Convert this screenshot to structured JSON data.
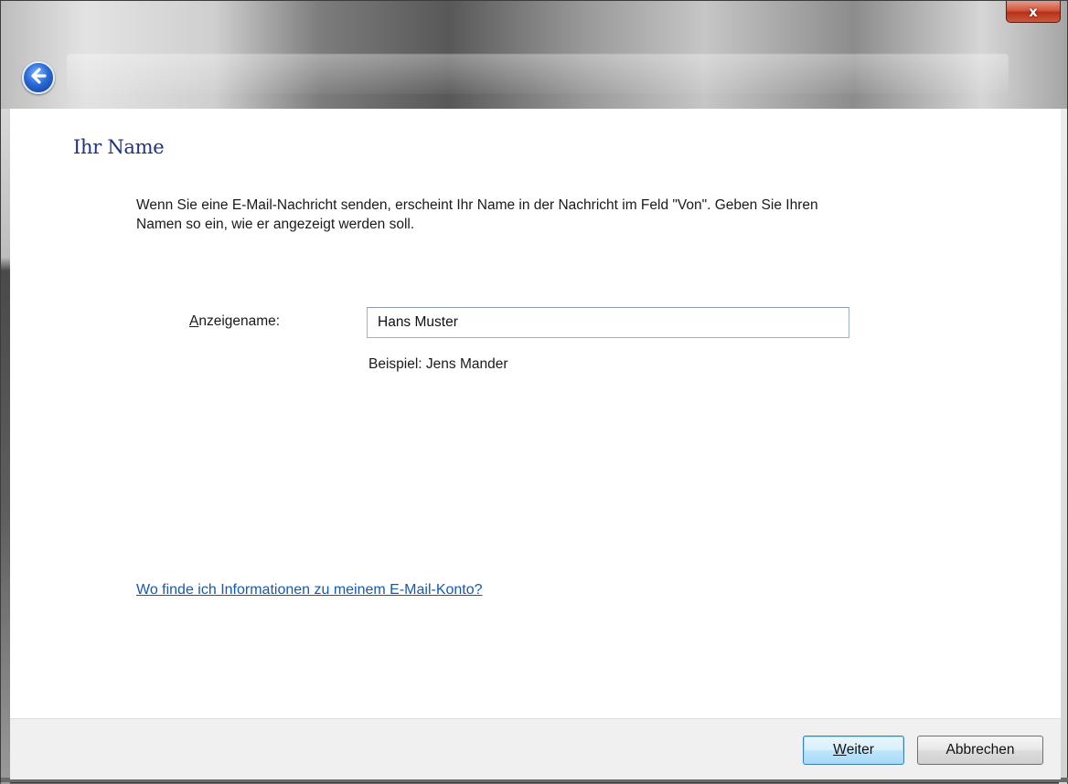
{
  "window": {
    "title": "",
    "close_symbol": "x",
    "back_icon": "back-arrow-icon"
  },
  "page": {
    "title": "Ihr Name",
    "description": "Wenn Sie eine E-Mail-Nachricht senden, erscheint Ihr Name in der Nachricht im Feld \"Von\". Geben Sie Ihren Namen so ein, wie er angezeigt werden soll."
  },
  "form": {
    "display_name_label_access": "A",
    "display_name_label_rest": "nzeigename:",
    "display_name_value": "Hans Muster",
    "example": "Beispiel: Jens Mander"
  },
  "help_link": "Wo finde ich Informationen zu meinem E-Mail-Konto?",
  "footer": {
    "next_access": "W",
    "next_rest": "eiter",
    "cancel_label": "Abbrechen"
  },
  "colors": {
    "title": "#1e3287",
    "link": "#1559b6",
    "close_button": "#c9452b"
  }
}
